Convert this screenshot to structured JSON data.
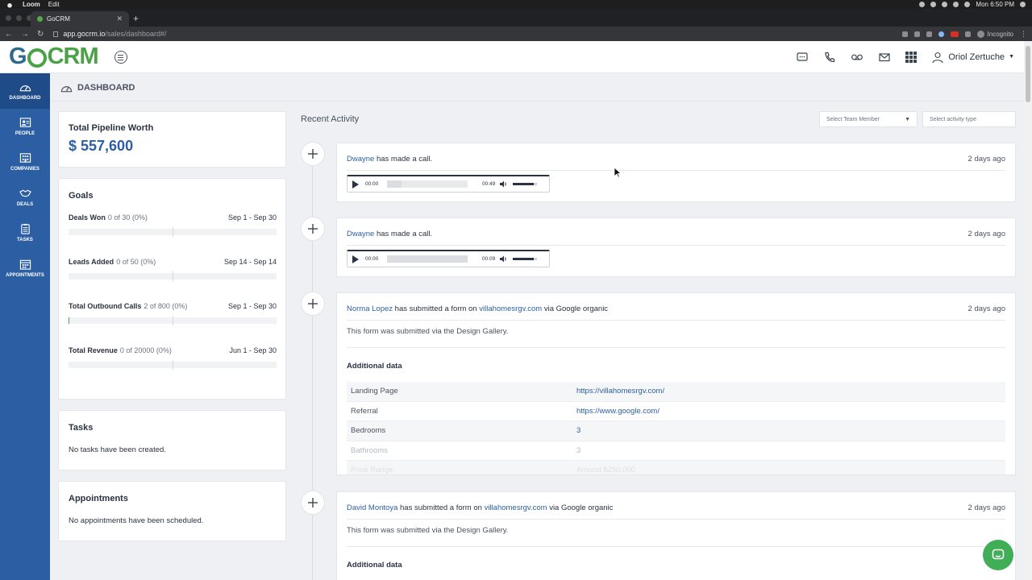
{
  "menubar": {
    "app": "Loom",
    "edit": "Edit",
    "clock": "Mon 6:50 PM"
  },
  "browser": {
    "tab_title": "GoCRM",
    "url_host": "app.gocrm.io",
    "url_path": "/sales/dashboard#/",
    "incognito": "Incognito"
  },
  "header": {
    "logo_go": "G",
    "logo_crm": "CRM",
    "user_name": "Oriol Zertuche"
  },
  "sidebar": {
    "items": [
      {
        "label": "DASHBOARD",
        "icon": "dashboard-icon"
      },
      {
        "label": "PEOPLE",
        "icon": "people-icon"
      },
      {
        "label": "COMPANIES",
        "icon": "companies-icon"
      },
      {
        "label": "DEALS",
        "icon": "handshake-icon"
      },
      {
        "label": "TASKS",
        "icon": "clipboard-icon"
      },
      {
        "label": "APPOINTMENTS",
        "icon": "calendar-icon"
      }
    ]
  },
  "page": {
    "title": "DASHBOARD"
  },
  "pipeline": {
    "label": "Total Pipeline Worth",
    "amount": "$ 557,600"
  },
  "goals": {
    "title": "Goals",
    "items": [
      {
        "name": "Deals Won",
        "progress": "0 of 30 (0%)",
        "dates": "Sep 1 - Sep 30",
        "percent": 0
      },
      {
        "name": "Leads Added",
        "progress": "0 of 50 (0%)",
        "dates": "Sep 14 - Sep 14",
        "percent": 0
      },
      {
        "name": "Total Outbound Calls",
        "progress": "2 of 800 (0%)",
        "dates": "Sep 1 - Sep 30",
        "percent": 0.25
      },
      {
        "name": "Total Revenue",
        "progress": "0 of 20000 (0%)",
        "dates": "Jun 1 - Sep 30",
        "percent": 0
      }
    ]
  },
  "tasks": {
    "title": "Tasks",
    "empty": "No tasks have been created."
  },
  "appointments": {
    "title": "Appointments",
    "empty": "No appointments have been scheduled."
  },
  "activity": {
    "title": "Recent Activity",
    "team_placeholder": "Select Team Member",
    "type_placeholder": "Select activity type",
    "items": [
      {
        "who": "Dwayne",
        "action": "has made a call.",
        "time": "2 days ago",
        "audio_start": "00:00",
        "audio_end": "00:49"
      },
      {
        "who": "Dwayne",
        "action": "has made a call.",
        "time": "2 days ago",
        "audio_start": "00:00",
        "audio_end": "00:09"
      },
      {
        "who": "Norma Lopez",
        "action": "has submitted a form on",
        "site": "villahomesrgv.com",
        "via": "via Google organic",
        "time": "2 days ago",
        "desc": "This form was submitted via the Design Gallery.",
        "additional": "Additional data",
        "rows": [
          {
            "k": "Landing Page",
            "v": "https://villahomesrgv.com/"
          },
          {
            "k": "Referral",
            "v": "https://www.google.com/"
          },
          {
            "k": "Bedrooms",
            "v": "3"
          },
          {
            "k": "Bathrooms",
            "v": "3"
          },
          {
            "k": "Price Range",
            "v": "Around $250,000"
          }
        ]
      },
      {
        "who": "David Montoya",
        "action": "has submitted a form on",
        "site": "villahomesrgv.com",
        "via": "via Google organic",
        "time": "2 days ago",
        "desc": "This form was submitted via the Design Gallery.",
        "additional": "Additional data"
      }
    ]
  },
  "colors": {
    "brand_blue": "#2c5ea3",
    "brand_green": "#4aa246",
    "sidebar": "#2c5ea3",
    "chat": "#3fae56"
  }
}
